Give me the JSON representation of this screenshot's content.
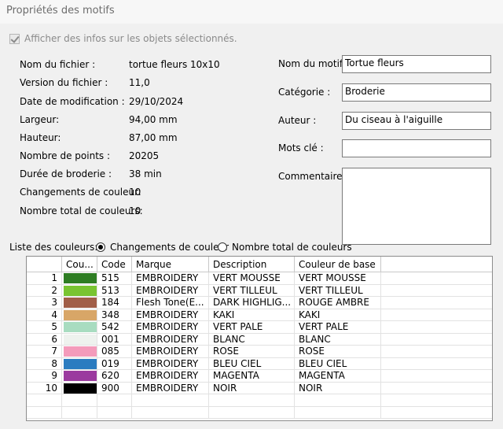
{
  "window": {
    "title": "Propriétés des motifs"
  },
  "show_info_checkbox": {
    "label": "Afficher des infos sur les objets sélectionnés.",
    "checked": true,
    "enabled": false
  },
  "file_info": [
    {
      "label": "Nom du fichier :",
      "value": "tortue fleurs 10x10"
    },
    {
      "label": "Version du fichier :",
      "value": "11,0"
    },
    {
      "label": "Date de modification :",
      "value": "29/10/2024"
    },
    {
      "label": "Largeur:",
      "value": "94,00 mm"
    },
    {
      "label": "Hauteur:",
      "value": "87,00 mm"
    },
    {
      "label": "Nombre de points :",
      "value": "20205"
    },
    {
      "label": "Durée de broderie :",
      "value": "38 min"
    },
    {
      "label": "Changements de couleur:",
      "value": "10"
    },
    {
      "label": "Nombre total de couleurs:",
      "value": "10"
    }
  ],
  "form": {
    "design_name": {
      "label": "Nom du motif :",
      "value": "Tortue fleurs"
    },
    "category": {
      "label": "Catégorie :",
      "value": "Broderie"
    },
    "author": {
      "label": "Auteur :",
      "value": "Du ciseau à l'aiguille"
    },
    "keywords": {
      "label": "Mots clé :",
      "value": ""
    },
    "comments": {
      "label": "Commentaires :",
      "value": ""
    }
  },
  "color_list": {
    "label": "Liste des couleurs:",
    "options": [
      {
        "label": "Changements de couleur",
        "selected": true
      },
      {
        "label": "Nombre total de couleurs",
        "selected": false
      }
    ],
    "columns": [
      "Cou...",
      "Code",
      "Marque",
      "Description",
      "Couleur de base"
    ],
    "rows": [
      {
        "num": "1",
        "color": "#2e7d23",
        "code": "515",
        "brand": "EMBROIDERY",
        "description": "VERT MOUSSE",
        "base": "VERT MOUSSE"
      },
      {
        "num": "2",
        "color": "#79c431",
        "code": "513",
        "brand": "EMBROIDERY",
        "description": "VERT TILLEUL",
        "base": "VERT TILLEUL"
      },
      {
        "num": "3",
        "color": "#a15e48",
        "code": "184",
        "brand": "Flesh Tone(E...",
        "description": "DARK HIGHLIG...",
        "base": "ROUGE AMBRE"
      },
      {
        "num": "4",
        "color": "#d8a667",
        "code": "348",
        "brand": "EMBROIDERY",
        "description": "KAKI",
        "base": "KAKI"
      },
      {
        "num": "5",
        "color": "#a8dcc0",
        "code": "542",
        "brand": "EMBROIDERY",
        "description": "VERT PALE",
        "base": "VERT PALE"
      },
      {
        "num": "6",
        "color": "#eef2ee",
        "code": "001",
        "brand": "EMBROIDERY",
        "description": "BLANC",
        "base": "BLANC"
      },
      {
        "num": "7",
        "color": "#f49bbb",
        "code": "085",
        "brand": "EMBROIDERY",
        "description": "ROSE",
        "base": "ROSE"
      },
      {
        "num": "8",
        "color": "#2b7cc0",
        "code": "019",
        "brand": "EMBROIDERY",
        "description": "BLEU CIEL",
        "base": "BLEU CIEL"
      },
      {
        "num": "9",
        "color": "#9b3a9f",
        "code": "620",
        "brand": "EMBROIDERY",
        "description": "MAGENTA",
        "base": "MAGENTA"
      },
      {
        "num": "10",
        "color": "#000000",
        "code": "900",
        "brand": "EMBROIDERY",
        "description": "NOIR",
        "base": "NOIR"
      }
    ]
  }
}
